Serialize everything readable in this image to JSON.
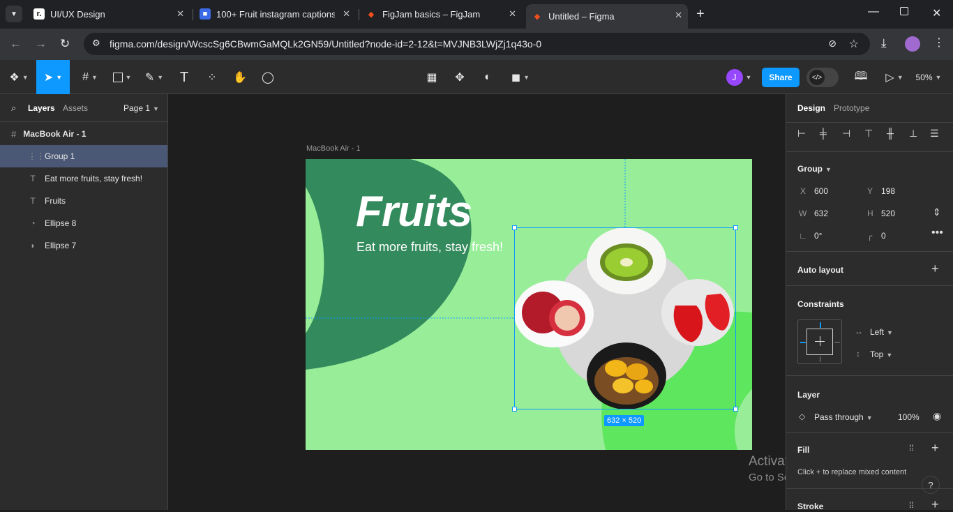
{
  "tabs": [
    {
      "title": "UI/UX Design",
      "favicon": "r-logo-icon"
    },
    {
      "title": "100+ Fruit instagram captions",
      "favicon": "doc-icon"
    },
    {
      "title": "FigJam basics – FigJam",
      "favicon": "figma-icon"
    },
    {
      "title": "Untitled – Figma",
      "favicon": "figma-icon"
    }
  ],
  "url": "figma.com/design/WcscSg6CBwmGaMQLk2GN59/Untitled?node-id=2-12&t=MVJNB3LWjZj1q43o-0",
  "toolbar": {
    "share_label": "Share",
    "zoom": "50%",
    "avatar_initial": "J"
  },
  "left": {
    "tab_layers": "Layers",
    "tab_assets": "Assets",
    "page": "Page 1",
    "frame": "MacBook Air - 1",
    "layers": [
      {
        "name": "Group 1",
        "icon": "group-icon"
      },
      {
        "name": "Eat more fruits, stay fresh!",
        "icon": "text-icon"
      },
      {
        "name": "Fruits",
        "icon": "text-icon"
      },
      {
        "name": "Ellipse 8",
        "icon": "ellipse-icon"
      },
      {
        "name": "Ellipse 7",
        "icon": "ellipse-icon"
      }
    ]
  },
  "canvas": {
    "frame_label": "MacBook Air - 1",
    "title": "Fruits",
    "subtitle": "Eat more fruits, stay fresh!",
    "size_badge": "632 × 520",
    "watermark_title": "Activate Windows",
    "watermark_sub": "Go to Settings to activate Windows.",
    "colors": {
      "frame_bg": "#98ee98",
      "shape_dark": "#338a5c",
      "shape_bright": "#5fe65f",
      "selection": "#0d99ff"
    }
  },
  "right": {
    "tab_design": "Design",
    "tab_prototype": "Prototype",
    "group_label": "Group",
    "x_label": "X",
    "x": "600",
    "y_label": "Y",
    "y": "198",
    "w_label": "W",
    "w": "632",
    "h_label": "H",
    "h": "520",
    "rotation": "0°",
    "radius": "0",
    "auto_layout": "Auto layout",
    "constraints": "Constraints",
    "c_h": "Left",
    "c_v": "Top",
    "layer": "Layer",
    "blend": "Pass through",
    "opacity": "100%",
    "fill": "Fill",
    "fill_note": "Click + to replace mixed content",
    "stroke": "Stroke"
  }
}
